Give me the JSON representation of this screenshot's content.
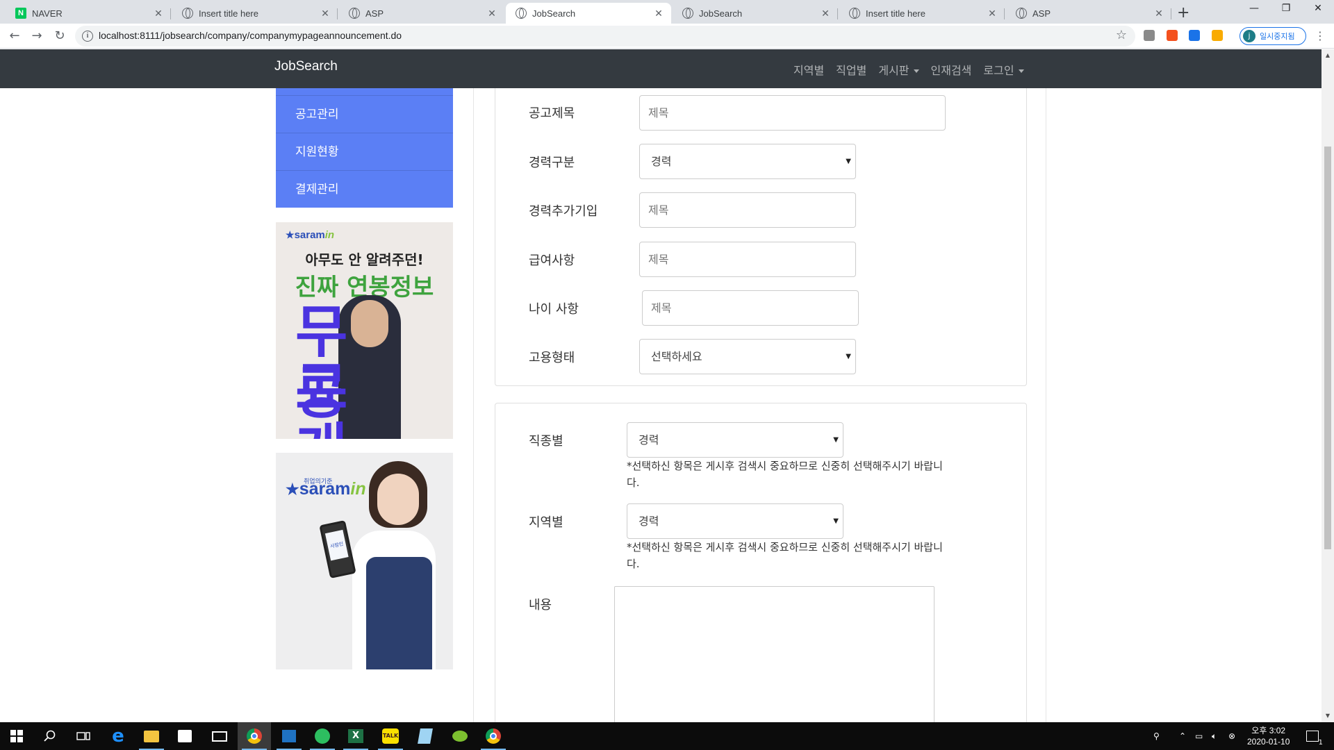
{
  "browser": {
    "tabs": [
      {
        "title": "NAVER",
        "favicon": "naver-icon"
      },
      {
        "title": "Insert title here",
        "favicon": "globe-icon"
      },
      {
        "title": "ASP",
        "favicon": "globe-icon"
      },
      {
        "title": "JobSearch",
        "favicon": "globe-icon",
        "active": true
      },
      {
        "title": "JobSearch",
        "favicon": "globe-icon"
      },
      {
        "title": "Insert title here",
        "favicon": "globe-icon"
      },
      {
        "title": "ASP",
        "favicon": "globe-icon"
      }
    ],
    "url": "localhost:8111/jobsearch/company/companymypageannouncement.do",
    "profile_label": "일시중지됨",
    "profile_initial": "j"
  },
  "navbar": {
    "brand": "JobSearch",
    "links": [
      "지역별",
      "직업별",
      "게시판",
      "인재검색",
      "로그인"
    ]
  },
  "sidemenu": {
    "items": [
      "공고관리",
      "지원현황",
      "결제관리"
    ]
  },
  "ads": {
    "ad1": {
      "logo": "saram",
      "logo_suffix": "in",
      "line1": "아무도 안 알려주던!",
      "line2": "진짜 연봉정보",
      "line3a": "무료",
      "line3b": "공개"
    },
    "ad2": {
      "tagline": "취업의기준",
      "logo": "saram",
      "logo_suffix": "in",
      "phone_label": "사람인"
    }
  },
  "form1": {
    "title": {
      "label": "공고제목",
      "placeholder": "제목"
    },
    "career": {
      "label": "경력구분",
      "value": "경력"
    },
    "career_company": {
      "label": "경력추가기입",
      "placeholder": "제목"
    },
    "salary": {
      "label": "급여사항",
      "placeholder": "제목"
    },
    "age": {
      "label": "나이 사항",
      "placeholder": "제목"
    },
    "employment": {
      "label": "고용형태",
      "value": "선택하세요"
    }
  },
  "form2": {
    "job": {
      "label": "직종별",
      "value": "경력",
      "note": "*선택하신 항목은 게시후 검색시 중요하므로 신중히 선택해주시기 바랍니다."
    },
    "region": {
      "label": "지역별",
      "value": "경력",
      "note": "*선택하신 항목은 게시후 검색시 중요하므로 신중히 선택해주시기 바랍니다."
    },
    "content": {
      "label": "내용"
    }
  },
  "taskbar": {
    "clock_time": "오후 3:02",
    "clock_date": "2020-01-10",
    "notification_count": "1"
  },
  "colors": {
    "navbar_bg": "#343a40",
    "sidemenu_bg": "#5b7ff5",
    "brand_accent": "#2b4fb8"
  }
}
